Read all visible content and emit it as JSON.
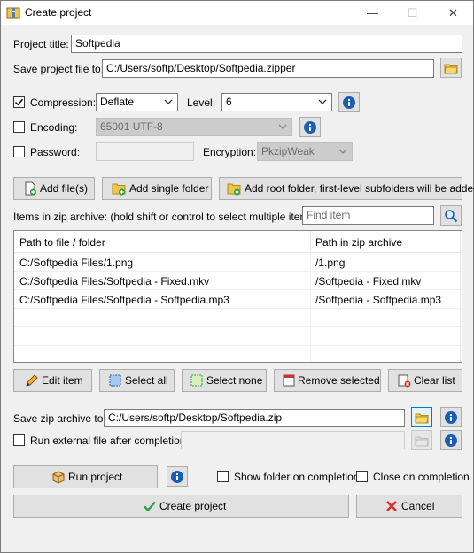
{
  "window": {
    "title": "Create project",
    "minimize": "—",
    "maximize": "☐",
    "close": "✕"
  },
  "project": {
    "title_label": "Project title:",
    "title_value": "Softpedia",
    "save_label": "Save project file to:",
    "save_value": "C:/Users/softp/Desktop/Softpedia.zipper"
  },
  "compression": {
    "label": "Compression:",
    "checked": true,
    "method": "Deflate",
    "level_label": "Level:",
    "level": "6"
  },
  "encoding": {
    "label": "Encoding:",
    "checked": false,
    "value": "65001 UTF-8"
  },
  "password": {
    "label": "Password:",
    "checked": false,
    "value": "",
    "encryption_label": "Encryption:",
    "encryption_value": "PkzipWeak"
  },
  "add_buttons": {
    "add_files": "Add file(s)",
    "add_single_folder": "Add single folder",
    "add_root_folder": "Add root folder, first-level subfolders will be added"
  },
  "items": {
    "label": "Items in zip archive: (hold shift or control to select multiple items)",
    "find_placeholder": "Find item",
    "columns": [
      "Path to file / folder",
      "Path in zip archive"
    ],
    "rows": [
      {
        "path": "C:/Softpedia Files/1.png",
        "zip_path": "/1.png"
      },
      {
        "path": "C:/Softpedia Files/Softpedia - Fixed.mkv",
        "zip_path": "/Softpedia - Fixed.mkv"
      },
      {
        "path": "C:/Softpedia Files/Softpedia - Softpedia.mp3",
        "zip_path": "/Softpedia - Softpedia.mp3"
      }
    ]
  },
  "list_buttons": {
    "edit_item": "Edit item",
    "select_all": "Select all",
    "select_none": "Select none",
    "remove_selected": "Remove selected",
    "clear_list": "Clear list"
  },
  "output": {
    "save_zip_label": "Save zip archive to:",
    "save_zip_value": "C:/Users/softp/Desktop/Softpedia.zip",
    "run_external_label": "Run external file after completion:",
    "run_external_checked": false,
    "run_external_value": ""
  },
  "actions": {
    "run_project": "Run project",
    "show_folder": "Show folder on completion",
    "show_folder_checked": false,
    "close_on_completion": "Close on completion",
    "close_on_completion_checked": false,
    "create_project": "Create project",
    "cancel": "Cancel"
  },
  "colors": {
    "accent": "#0078d7",
    "info_blue": "#1a5fb4",
    "folder_yellow": "#f2c744",
    "ok_green": "#2ea043",
    "cancel_red": "#d32f2f"
  },
  "icons": {
    "app": "archive-icon",
    "browse": "folder-icon",
    "info": "info-icon",
    "search": "magnifier-icon"
  }
}
